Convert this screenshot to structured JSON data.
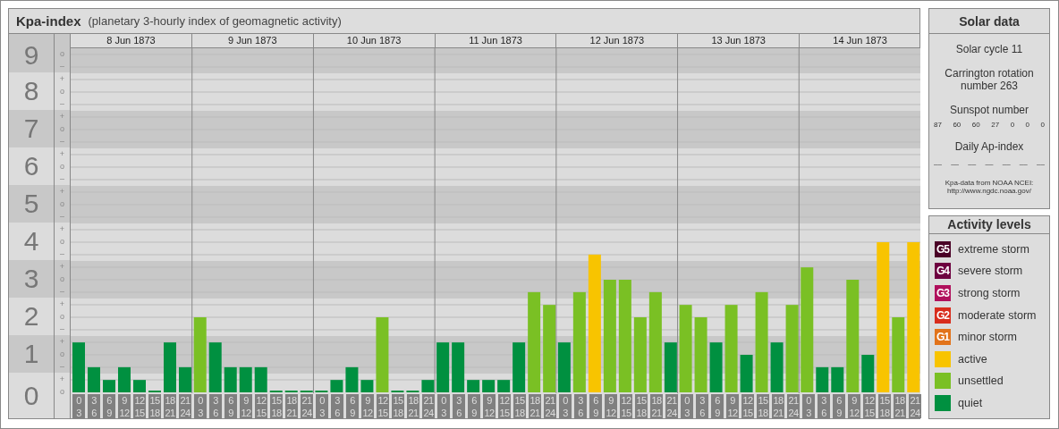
{
  "kpa_panel": {
    "title": "Kpa-index",
    "subtitle": "(planetary 3-hourly index of geomagnetic activity)",
    "days": [
      "8 Jun 1873",
      "9 Jun 1873",
      "10 Jun 1873",
      "11 Jun 1873",
      "12 Jun 1873",
      "13 Jun 1873",
      "14 Jun 1873"
    ],
    "scale_marks": [
      [
        "o",
        "–"
      ],
      [
        "+",
        "o",
        "–"
      ],
      [
        "+",
        "o",
        "–"
      ],
      [
        "+",
        "o",
        "–"
      ],
      [
        "+",
        "o",
        "–"
      ],
      [
        "+",
        "o",
        "–"
      ],
      [
        "+",
        "o",
        "–"
      ],
      [
        "+",
        "o",
        "–"
      ],
      [
        "+",
        "o",
        "–"
      ],
      [
        "+",
        "o"
      ]
    ],
    "chart_data": {
      "type": "bar",
      "ylim": [
        0,
        9
      ],
      "yticks": [
        9,
        8,
        7,
        6,
        5,
        4,
        3,
        2,
        1,
        0
      ],
      "grid": true,
      "categories": [
        "0\n3",
        "3\n6",
        "6\n9",
        "9\n12",
        "12\n15",
        "15\n18",
        "18\n21",
        "21\n24",
        "0\n3",
        "3\n6",
        "6\n9",
        "9\n12",
        "12\n15",
        "15\n18",
        "18\n21",
        "21\n24",
        "0\n3",
        "3\n6",
        "6\n9",
        "9\n12",
        "12\n15",
        "15\n18",
        "18\n21",
        "21\n24",
        "0\n3",
        "3\n6",
        "6\n9",
        "9\n12",
        "12\n15",
        "15\n18",
        "18\n21",
        "21\n24",
        "0\n3",
        "3\n6",
        "6\n9",
        "9\n12",
        "12\n15",
        "15\n18",
        "18\n21",
        "21\n24",
        "0\n3",
        "3\n6",
        "6\n9",
        "9\n12",
        "12\n15",
        "15\n18",
        "18\n21",
        "21\n24",
        "0\n3",
        "3\n6",
        "6\n9",
        "9\n12",
        "12\n15",
        "15\n18",
        "18\n21",
        "21\n24"
      ],
      "series": [
        {
          "color": "#009040",
          "values": [
            1.33,
            0.67,
            0.33,
            0.67,
            0.33,
            0,
            1.33,
            0.67,
            null,
            1.33,
            0.67,
            0.67,
            0.67,
            0,
            0,
            0,
            0,
            0.33,
            0.67,
            0.33,
            null,
            0,
            0,
            0.33,
            1.33,
            1.33,
            0.33,
            0.33,
            0.33,
            1.33,
            null,
            null,
            1.33,
            null,
            null,
            null,
            null,
            null,
            null,
            1.33,
            null,
            null,
            1.33,
            null,
            1,
            null,
            1.33,
            null,
            null,
            0.67,
            0.67,
            null,
            1,
            null,
            null,
            null
          ]
        },
        {
          "color": "#7ac024",
          "values": [
            null,
            null,
            null,
            null,
            null,
            null,
            null,
            null,
            2,
            null,
            null,
            null,
            null,
            null,
            null,
            null,
            null,
            null,
            null,
            null,
            2,
            null,
            null,
            null,
            null,
            null,
            null,
            null,
            null,
            null,
            2.67,
            2.33,
            null,
            2.67,
            null,
            3,
            3,
            2,
            2.67,
            null,
            2.33,
            2,
            null,
            2.33,
            null,
            2.67,
            null,
            2.33,
            3.33,
            null,
            null,
            3,
            null,
            null,
            2,
            null
          ]
        },
        {
          "color": "#f8c400",
          "values": [
            null,
            null,
            null,
            null,
            null,
            null,
            null,
            null,
            null,
            null,
            null,
            null,
            null,
            null,
            null,
            null,
            null,
            null,
            null,
            null,
            null,
            null,
            null,
            null,
            null,
            null,
            null,
            null,
            null,
            null,
            null,
            null,
            null,
            null,
            3.67,
            null,
            null,
            null,
            null,
            null,
            null,
            null,
            null,
            null,
            null,
            null,
            null,
            null,
            null,
            null,
            null,
            null,
            null,
            4,
            null,
            4
          ]
        }
      ]
    }
  },
  "solar_data": {
    "title": "Solar data",
    "solar_cycle": "Solar cycle 11",
    "carrington": "Carrington rotation number 263",
    "sunspot_title": "Sunspot number",
    "sunspot_numbers": [
      "87",
      "60",
      "60",
      "27",
      "0",
      "0",
      "0"
    ],
    "ap_title": "Daily Ap-index",
    "ap_values": [
      "––",
      "––",
      "––",
      "––",
      "––",
      "––",
      "––"
    ],
    "source": "Kpa-data from NOAA NCEI:",
    "source_url": "http://www.ngdc.noaa.gov/"
  },
  "activity_levels": {
    "title": "Activity levels",
    "items": [
      {
        "badge": "G5",
        "label": "extreme storm",
        "color": "#4a0026"
      },
      {
        "badge": "G4",
        "label": "severe storm",
        "color": "#6e0040"
      },
      {
        "badge": "G3",
        "label": "strong storm",
        "color": "#b0105c"
      },
      {
        "badge": "G2",
        "label": "moderate storm",
        "color": "#d82c1c"
      },
      {
        "badge": "G1",
        "label": "minor storm",
        "color": "#e2731a"
      },
      {
        "label": "active",
        "color": "#f8c400"
      },
      {
        "label": "unsettled",
        "color": "#7ac024"
      },
      {
        "label": "quiet",
        "color": "#009040"
      }
    ]
  }
}
